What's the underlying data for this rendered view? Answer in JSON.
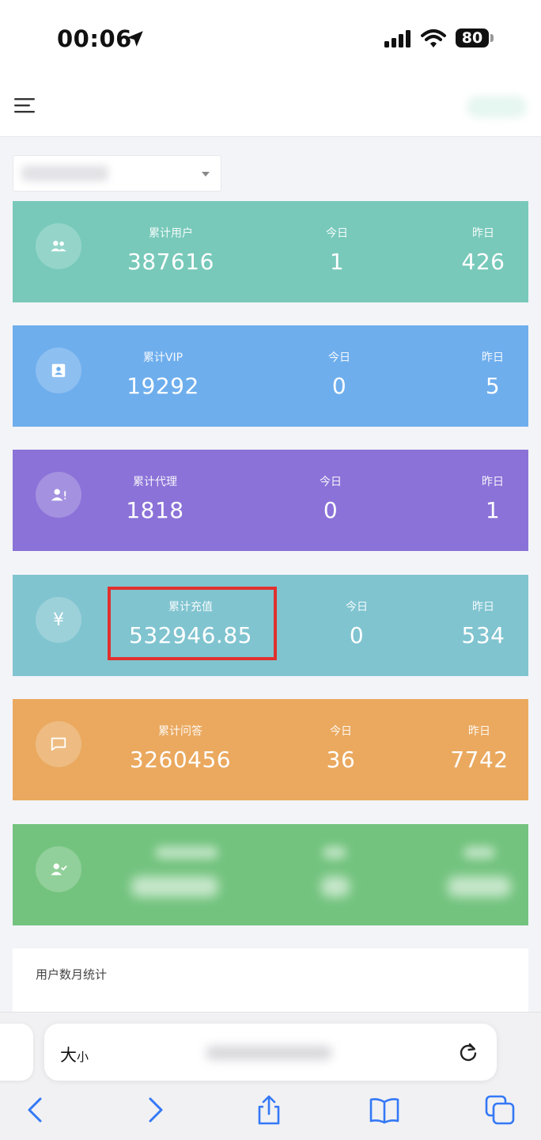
{
  "status_bar": {
    "time": "00:06",
    "battery": "80"
  },
  "stat_cards": [
    {
      "label": "累计用户",
      "value": "387616",
      "today_label": "今日",
      "today": "1",
      "yesterday_label": "昨日",
      "yesterday": "426",
      "icon": "users-icon",
      "color": "#78c9ba"
    },
    {
      "label": "累计VIP",
      "value": "19292",
      "today_label": "今日",
      "today": "0",
      "yesterday_label": "昨日",
      "yesterday": "5",
      "icon": "id-card-icon",
      "color": "#6eaeed"
    },
    {
      "label": "累计代理",
      "value": "1818",
      "today_label": "今日",
      "today": "0",
      "yesterday_label": "昨日",
      "yesterday": "1",
      "icon": "agent-user-icon",
      "color": "#8b72d8"
    },
    {
      "label": "累计充值",
      "value": "532946.85",
      "today_label": "今日",
      "today": "0",
      "yesterday_label": "昨日",
      "yesterday": "534",
      "icon": "yuan-icon",
      "color": "#80c4d0"
    },
    {
      "label": "累计问答",
      "value": "3260456",
      "today_label": "今日",
      "today": "36",
      "yesterday_label": "昨日",
      "yesterday": "7742",
      "icon": "chat-icon",
      "color": "#eaa95f"
    },
    {
      "icon": "user-check-icon",
      "color": "#73c37e"
    }
  ],
  "stats_panel": {
    "title": "用户数月统计"
  },
  "browser": {
    "text_size_large": "大",
    "text_size_small": "小"
  },
  "icons": [
    "location-arrow-icon",
    "signal-icon",
    "wifi-icon",
    "menu-icon",
    "users-icon",
    "id-card-icon",
    "agent-user-icon",
    "yuan-icon",
    "chat-icon",
    "user-check-icon",
    "reload-icon",
    "back-icon",
    "forward-icon",
    "share-icon",
    "bookmarks-icon",
    "tabs-icon"
  ],
  "colors": {
    "highlight": "#e0312e",
    "browser_blue": "#3478f6"
  }
}
